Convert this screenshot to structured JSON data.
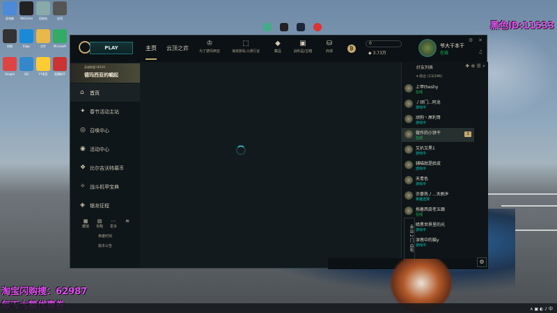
{
  "streamer_id": "黑色ID:11533",
  "promo": {
    "line1": "淘宝闪购搜：62987",
    "line2": "每天大额优惠卷"
  },
  "client": {
    "play_label": "PLAY",
    "nav": {
      "home": "主页",
      "tft": "云顶之弈"
    },
    "nav_icons": [
      {
        "label": "为了德玛西亚",
        "icon": "trophy-icon",
        "glyph": "♔"
      },
      {
        "label": "海克斯乱斗通行证",
        "icon": "pass-icon",
        "glyph": "⬚"
      },
      {
        "label": "藏品",
        "icon": "collection-icon",
        "glyph": "◆"
      },
      {
        "label": "战利品/宝箱",
        "icon": "loot-icon",
        "glyph": "▣"
      },
      {
        "label": "商城",
        "icon": "store-icon",
        "glyph": "⛁"
      }
    ],
    "currency": {
      "be": "0",
      "rp": "3.73万"
    },
    "profile": {
      "name": "爷大干本干",
      "status": "在线"
    }
  },
  "sidebar": {
    "banner_sub": "英雄联盟 S8190",
    "banner_title": "德玛西亚的崛起",
    "items": [
      {
        "label": "首页",
        "icon": "home-icon",
        "glyph": "⌂"
      },
      {
        "label": "春节活动主站",
        "icon": "event-icon",
        "glyph": "✦"
      },
      {
        "label": "召唤中心",
        "icon": "summon-icon",
        "glyph": "◎"
      },
      {
        "label": "活动中心",
        "icon": "activity-icon",
        "glyph": "◉"
      },
      {
        "label": "比尔吉沃特幕币",
        "icon": "coin-icon",
        "glyph": "❖"
      },
      {
        "label": "战斗机甲宝典",
        "icon": "mech-icon",
        "glyph": "✧"
      },
      {
        "label": "银龙征程",
        "icon": "dragon-icon",
        "glyph": "◈"
      }
    ],
    "mini": [
      {
        "label": "藏馆",
        "glyph": "▦"
      },
      {
        "label": "攻略",
        "glyph": "▤"
      },
      {
        "label": "更多",
        "glyph": "⋯"
      },
      {
        "label": "",
        "glyph": "≋"
      }
    ],
    "links": [
      "英雄时刻",
      "版本公告"
    ]
  },
  "friends": {
    "title": "好友列表",
    "group": "综合 (13/246)",
    "list": [
      {
        "name": "上甲theshy",
        "status": "在线",
        "type": "online"
      },
      {
        "name": "丿顽门...阿龙",
        "status": "游戏中",
        "type": "ingame"
      },
      {
        "name": "顽狗丶屌利哥",
        "status": "游戏中",
        "type": "ingame"
      },
      {
        "name": "做作的小饼干",
        "status": "在线",
        "type": "online",
        "badge": "3"
      },
      {
        "name": "又扒又黑1",
        "status": "游戏中",
        "type": "ingame"
      },
      {
        "name": "辅喵就是脸皮",
        "status": "游戏中",
        "type": "ingame"
      },
      {
        "name": "天青色",
        "status": "游戏中",
        "type": "ingame"
      },
      {
        "name": "亦豪热丿...天刷乡",
        "status": "英雄选择",
        "type": "ingame"
      },
      {
        "name": "拖着西皮老五跟",
        "status": "在线",
        "type": "online"
      },
      {
        "name": "暗黑世界里的光",
        "status": "游戏中",
        "type": "ingame"
      },
      {
        "name": "深巷中的猫y",
        "status": "游戏中",
        "type": "ingame"
      }
    ],
    "side_tab": "幸运 2 门 自有"
  },
  "desktop_icons": [
    {
      "label": "此电脑",
      "color": "#4a8ad8"
    },
    {
      "label": "WeGame",
      "color": "#222"
    },
    {
      "label": "回收站",
      "color": "#8aa"
    },
    {
      "label": "应用",
      "color": "#555"
    },
    {
      "label": "控制",
      "color": "#333"
    },
    {
      "label": "Edge",
      "color": "#1a8ad8"
    },
    {
      "label": "文件",
      "color": "#e8b84a"
    },
    {
      "label": "Microsoft",
      "color": "#3a6"
    },
    {
      "label": "Google",
      "color": "#d44"
    },
    {
      "label": "QQ",
      "color": "#38c"
    },
    {
      "label": "YY语音",
      "color": "#fc3"
    },
    {
      "label": "直播助手",
      "color": "#c33"
    }
  ]
}
